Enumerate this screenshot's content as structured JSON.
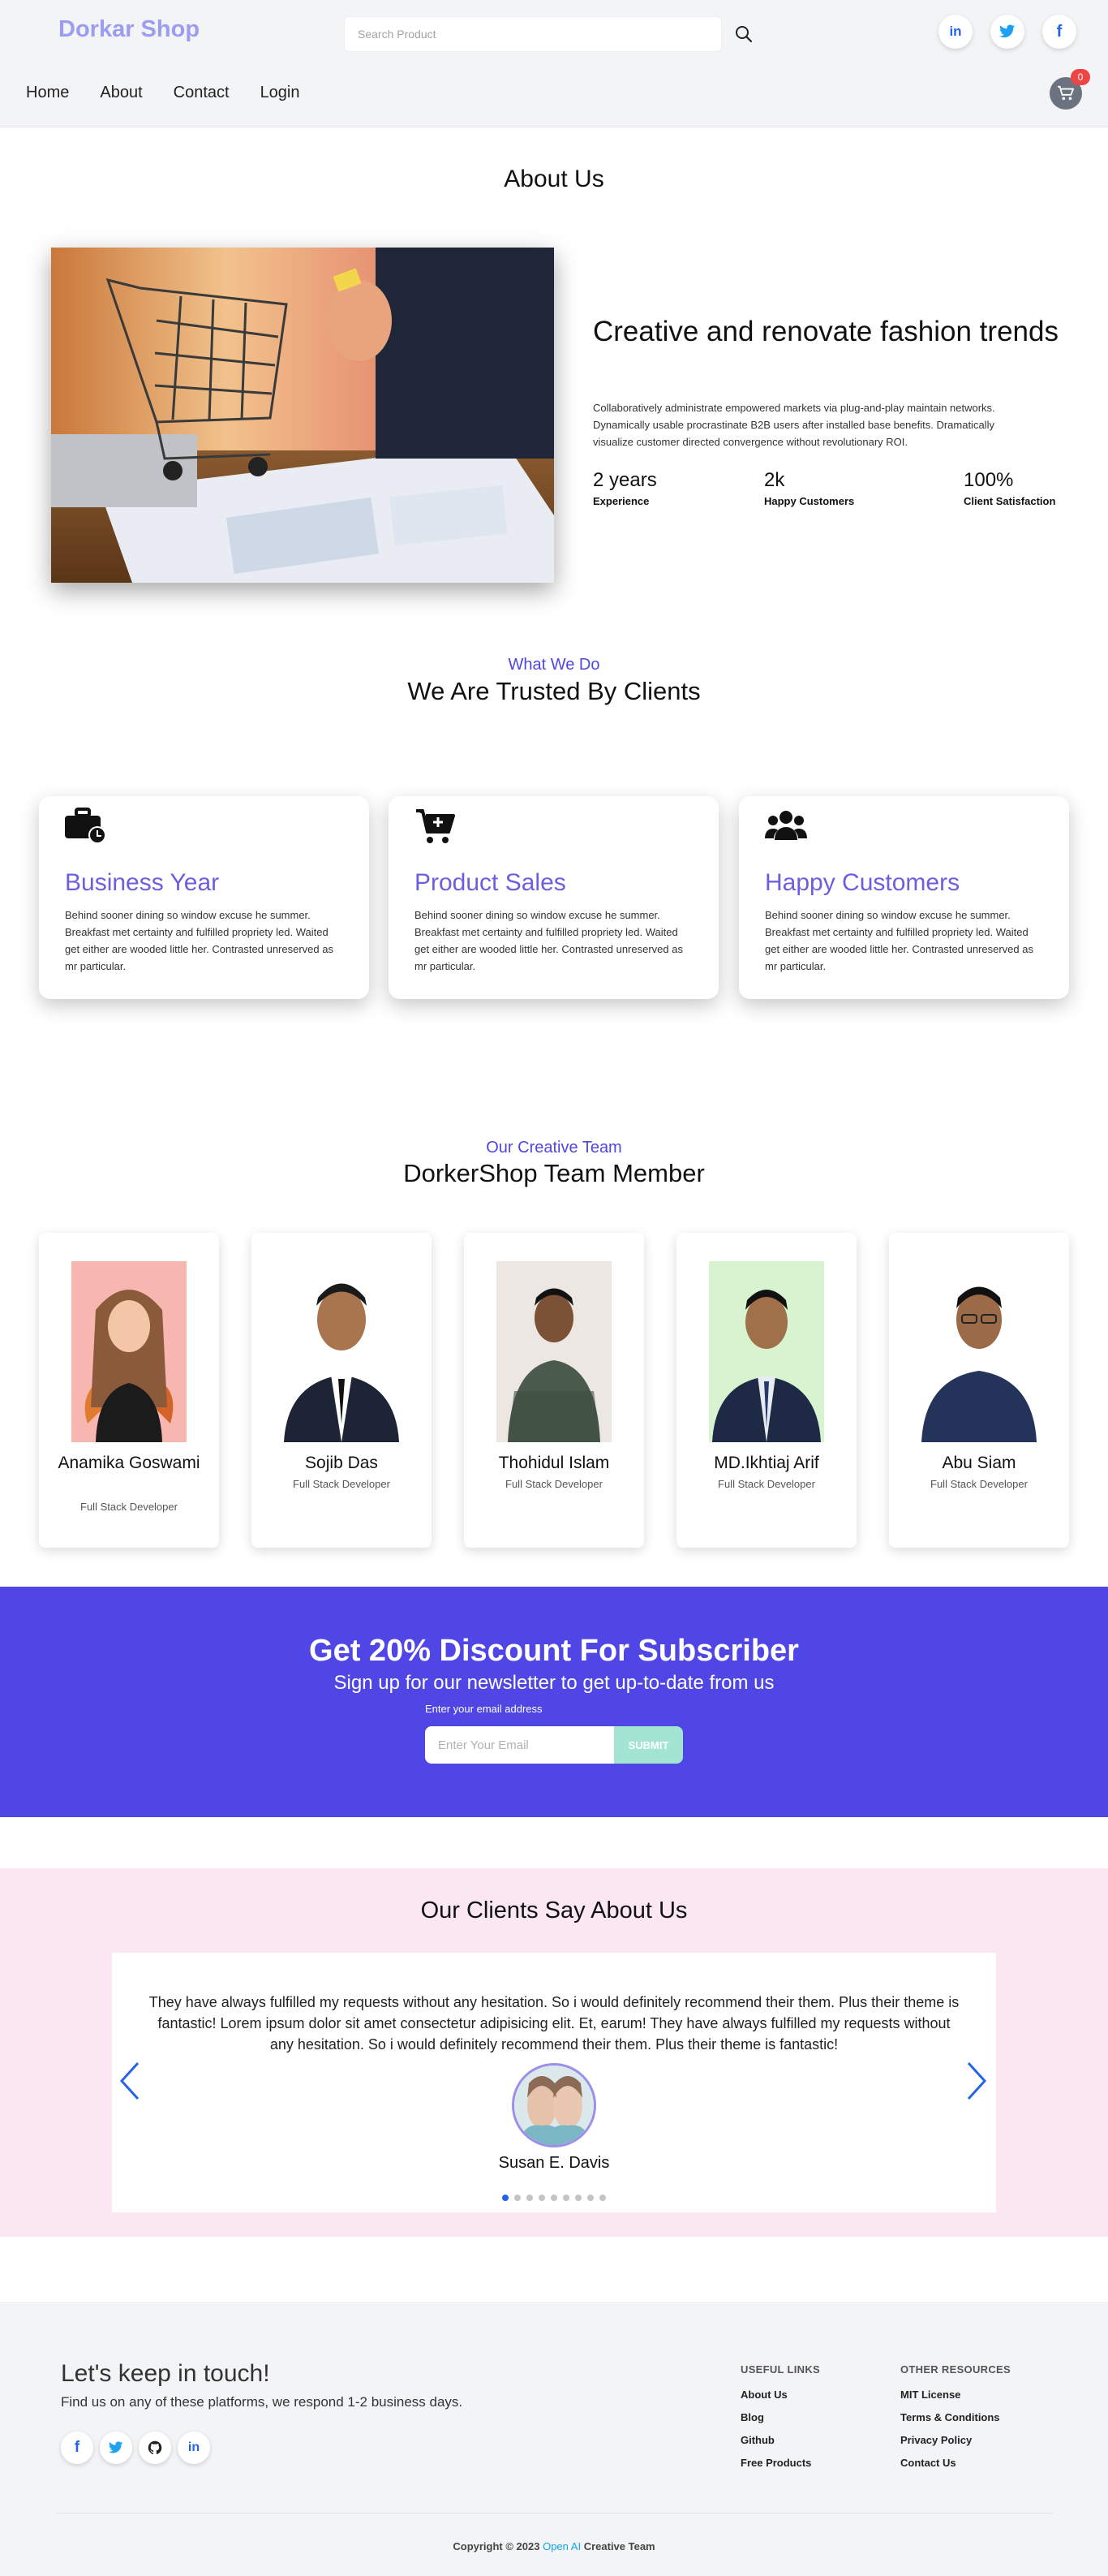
{
  "header": {
    "logo": "Dorkar Shop",
    "search_placeholder": "Search Product",
    "nav": [
      "Home",
      "About",
      "Contact",
      "Login"
    ],
    "cart_count": "0",
    "social_icons": [
      "linkedin-icon",
      "twitter-icon",
      "facebook-icon"
    ]
  },
  "about": {
    "title": "About Us",
    "heading": "Creative and renovate fashion trends",
    "text": "Collaboratively administrate empowered markets via plug-and-play maintain networks. Dynamically usable procrastinate B2B users after installed base benefits. Dramatically visualize customer directed convergence without revolutionary ROI.",
    "stats": [
      {
        "value": "2 years",
        "label": "Experience"
      },
      {
        "value": "2k",
        "label": "Happy Customers"
      },
      {
        "value": "100%",
        "label": "Client Satisfaction"
      }
    ]
  },
  "what_we_do": {
    "eyebrow": "What We Do",
    "title": "We Are Trusted By Clients",
    "cards": [
      {
        "icon": "business-time-icon",
        "title": "Business Year",
        "text": "Behind sooner dining so window excuse he summer. Breakfast met certainty and fulfilled propriety led. Waited get either are wooded little her. Contrasted unreserved as mr particular."
      },
      {
        "icon": "cart-plus-icon",
        "title": "Product Sales",
        "text": "Behind sooner dining so window excuse he summer. Breakfast met certainty and fulfilled propriety led. Waited get either are wooded little her. Contrasted unreserved as mr particular."
      },
      {
        "icon": "users-icon",
        "title": "Happy Customers",
        "text": "Behind sooner dining so window excuse he summer. Breakfast met certainty and fulfilled propriety led. Waited get either are wooded little her. Contrasted unreserved as mr particular."
      }
    ]
  },
  "team": {
    "eyebrow": "Our Creative Team",
    "title": "DorkerShop Team Member",
    "members": [
      {
        "name": "Anamika Goswami",
        "role": "Full Stack Developer"
      },
      {
        "name": "Sojib Das",
        "role": "Full Stack Developer"
      },
      {
        "name": "Thohidul Islam",
        "role": "Full Stack Developer"
      },
      {
        "name": "MD.Ikhtiaj Arif",
        "role": "Full Stack Developer"
      },
      {
        "name": "Abu Siam",
        "role": "Full Stack Developer"
      }
    ]
  },
  "subscribe": {
    "title": "Get 20% Discount For Subscriber",
    "subtitle": "Sign up for our newsletter to get up-to-date from us",
    "label": "Enter your email address",
    "placeholder": "Enter Your Email",
    "button": "SUBMIT"
  },
  "testimonials": {
    "title": "Our Clients Say About Us",
    "quote": "They have always fulfilled my requests without any hesitation. So i would definitely recommend their them. Plus their theme is fantastic! Lorem ipsum dolor sit amet consectetur adipisicing elit. Et, earum! They have always fulfilled my requests without any hesitation. So i would definitely recommend their them. Plus their theme is fantastic!",
    "name": "Susan E. Davis",
    "active_slide": 1,
    "slide_count": 9
  },
  "footer": {
    "title": "Let's keep in touch!",
    "subtitle": "Find us on any of these platforms, we respond 1-2 business days.",
    "social_icons": [
      "facebook-icon",
      "twitter-icon",
      "github-icon",
      "linkedin-icon"
    ],
    "useful_links": {
      "heading": "USEFUL LINKS",
      "links": [
        "About Us",
        "Blog",
        "Github",
        "Free Products"
      ]
    },
    "other_resources": {
      "heading": "OTHER RESOURCES",
      "links": [
        "MIT License",
        "Terms & Conditions",
        "Privacy Policy",
        "Contact Us"
      ]
    },
    "copyright_prefix": "Copyright © 2023",
    "copyright_brand": "Open AI",
    "copyright_suffix": "Creative Team"
  },
  "colors": {
    "accent": "#4f46e5",
    "logo": "#9c9cf0",
    "card_title": "#6b5fe0",
    "testimonial_bg": "#fbe7f1",
    "submit": "#a3e4d3",
    "badge": "#ef4444"
  }
}
